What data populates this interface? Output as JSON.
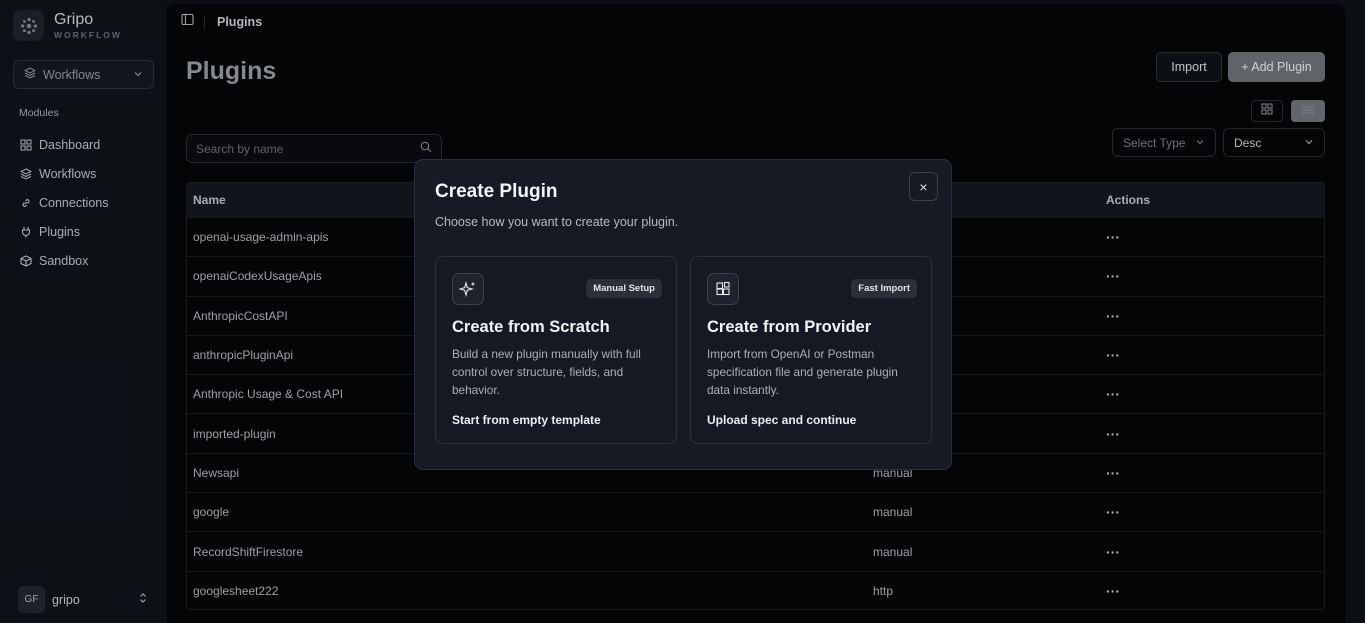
{
  "app": {
    "name": "Gripo",
    "subtitle": "WORKFLOW"
  },
  "sidebar": {
    "workspace_select": "Workflows",
    "modules_label": "Modules",
    "items": [
      {
        "label": "Dashboard",
        "icon": "grid-icon"
      },
      {
        "label": "Workflows",
        "icon": "layers-icon"
      },
      {
        "label": "Connections",
        "icon": "link-icon"
      },
      {
        "label": "Plugins",
        "icon": "plug-icon"
      },
      {
        "label": "Sandbox",
        "icon": "cube-icon"
      }
    ],
    "user": {
      "initials": "GF",
      "name": "gripo"
    }
  },
  "header": {
    "breadcrumb": "Plugins",
    "title": "Plugins",
    "import_label": "Import",
    "add_label": "+ Add Plugin"
  },
  "filters": {
    "search_placeholder": "Search by name",
    "type_select": "Select Type",
    "sort_select": "Desc"
  },
  "table": {
    "columns": {
      "name": "Name",
      "type": "",
      "actions": "Actions"
    },
    "rows": [
      {
        "name": "openai-usage-admin-apis",
        "type": ""
      },
      {
        "name": "openaiCodexUsageApis",
        "type": ""
      },
      {
        "name": "AnthropicCostAPI",
        "type": ""
      },
      {
        "name": "anthropicPluginApi",
        "type": ""
      },
      {
        "name": "Anthropic Usage & Cost API",
        "type": ""
      },
      {
        "name": "imported-plugin",
        "type": ""
      },
      {
        "name": "Newsapi",
        "type": "manual"
      },
      {
        "name": "google",
        "type": "manual"
      },
      {
        "name": "RecordShiftFirestore",
        "type": "manual"
      },
      {
        "name": "googlesheet222",
        "type": "http"
      }
    ],
    "row_action": "···"
  },
  "modal": {
    "title": "Create Plugin",
    "subtitle": "Choose how you want to create your plugin.",
    "close_icon": "×",
    "cards": [
      {
        "badge": "Manual Setup",
        "title": "Create from Scratch",
        "description": "Build a new plugin manually with full control over structure, fields, and behavior.",
        "cta": "Start from empty template"
      },
      {
        "badge": "Fast Import",
        "title": "Create from Provider",
        "description": "Import from OpenAI or Postman specification file and generate plugin data instantly.",
        "cta": "Upload spec and continue"
      }
    ]
  }
}
